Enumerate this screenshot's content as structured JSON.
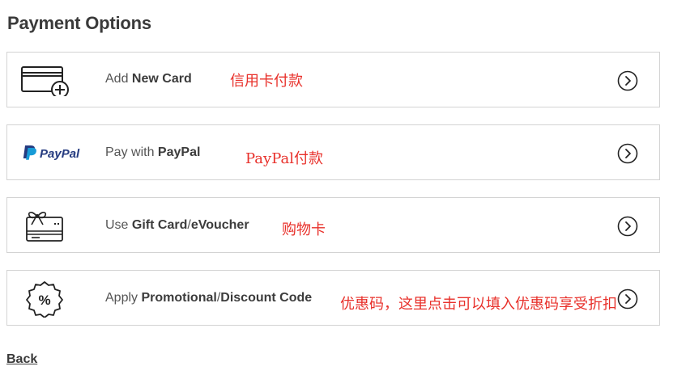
{
  "page": {
    "title": "Payment Options",
    "back_label": "Back"
  },
  "options": [
    {
      "icon": "credit-card-add-icon",
      "label_plain": "Add ",
      "label_bold": "New Card",
      "label_plain2": "",
      "label_bold2": "",
      "annotation": "信用卡付款"
    },
    {
      "icon": "paypal-logo",
      "logo_text": "PayPal",
      "label_plain": "Pay with ",
      "label_bold": "PayPal",
      "label_plain2": "",
      "label_bold2": "",
      "annotation": "PayPal付款"
    },
    {
      "icon": "gift-card-icon",
      "label_plain": "Use ",
      "label_bold": "Gift Card",
      "label_plain2": "/",
      "label_bold2": "eVoucher",
      "annotation": "购物卡"
    },
    {
      "icon": "percent-badge-icon",
      "label_plain": "Apply ",
      "label_bold": "Promotional",
      "label_plain2": "/",
      "label_bold2": "Discount Code",
      "annotation": "优惠码，这里点击可以填入优惠码享受折扣"
    }
  ],
  "colors": {
    "annotation": "#e8302a",
    "paypal_dark": "#253b80",
    "paypal_light": "#179bd7",
    "border": "#d3d3d3",
    "text": "#3a3a3a"
  }
}
